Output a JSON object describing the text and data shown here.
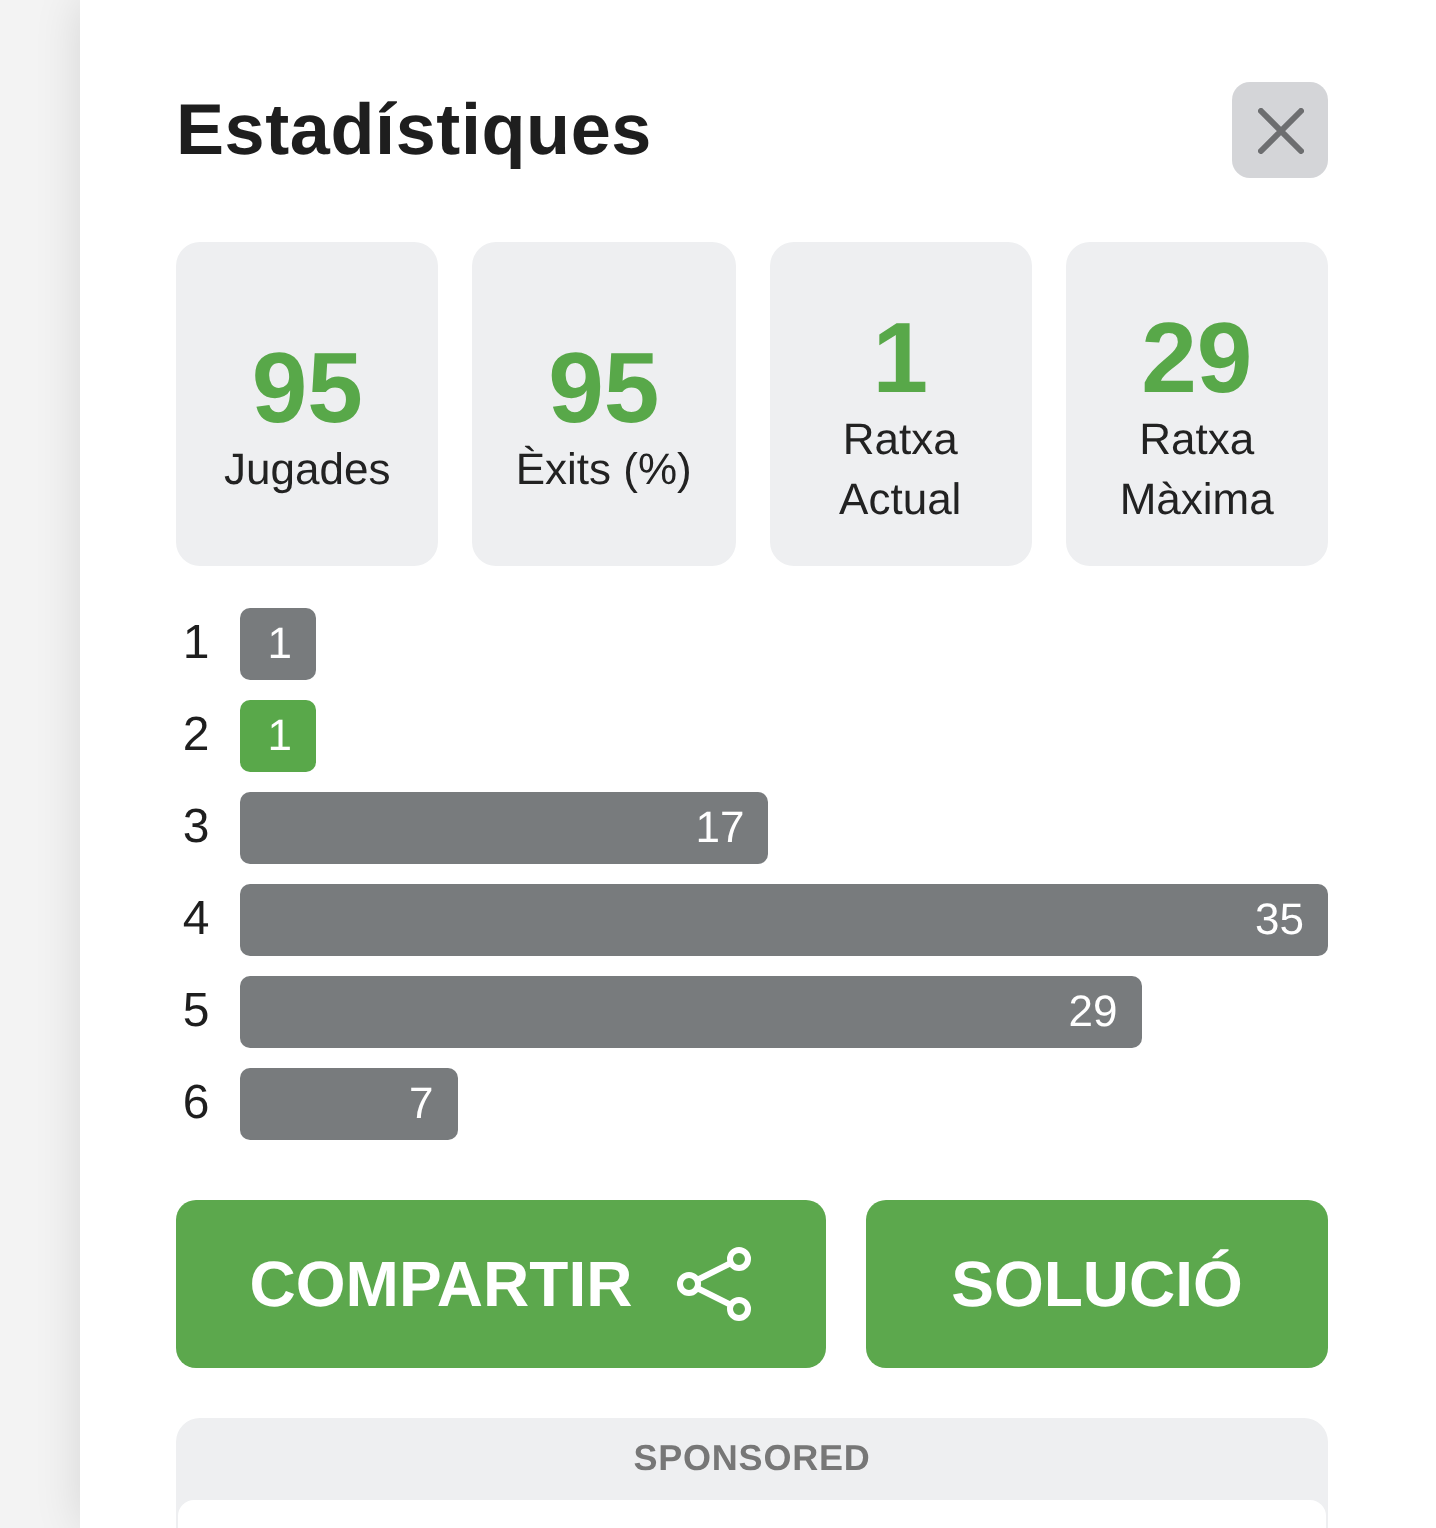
{
  "dialog": {
    "title": "Estadístiques"
  },
  "stats": [
    {
      "value": "95",
      "label": "Jugades"
    },
    {
      "value": "95",
      "label": "Èxits (%)"
    },
    {
      "value": "1",
      "label": "Ratxa Actual"
    },
    {
      "value": "29",
      "label": "Ratxa Màxima"
    }
  ],
  "distribution": [
    {
      "guess": "1",
      "count": "1",
      "highlighted": false
    },
    {
      "guess": "2",
      "count": "1",
      "highlighted": true
    },
    {
      "guess": "3",
      "count": "17",
      "highlighted": false
    },
    {
      "guess": "4",
      "count": "35",
      "highlighted": false
    },
    {
      "guess": "5",
      "count": "29",
      "highlighted": false
    },
    {
      "guess": "6",
      "count": "7",
      "highlighted": false
    }
  ],
  "buttons": [
    {
      "label": "COMPARTIR",
      "kind": "share"
    },
    {
      "label": "SOLUCIÓ",
      "kind": "plain"
    }
  ],
  "sponsor": {
    "label": "SPONSORED"
  }
}
